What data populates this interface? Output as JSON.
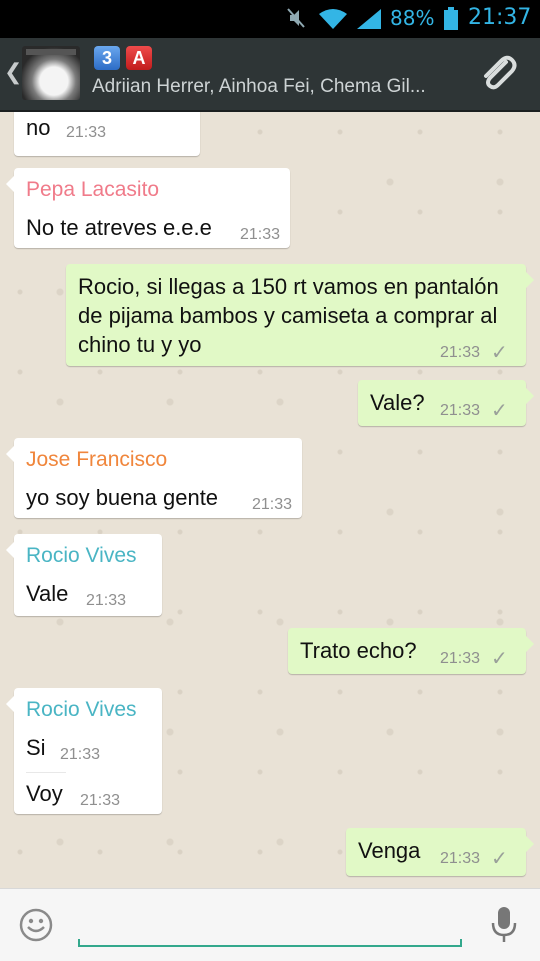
{
  "status_bar": {
    "battery_percent": "88%",
    "time": "21:37",
    "icons": [
      "mute-icon",
      "wifi-icon",
      "signal-icon",
      "battery-icon"
    ]
  },
  "header": {
    "back_glyph": "❮",
    "group_emoji": [
      "3",
      "A"
    ],
    "participants": "Adriian Herrer, Ainhoa Fei, Chema Gil...",
    "icons": [
      "back-icon",
      "group-avatar",
      "attach-icon"
    ]
  },
  "messages": [
    {
      "dir": "in",
      "sender": "",
      "text": "no",
      "time": "21:33"
    },
    {
      "dir": "in",
      "sender": "Pepa Lacasito",
      "sender_color": "#f07b8a",
      "text": "No te atreves e.e.e",
      "time": "21:33"
    },
    {
      "dir": "out",
      "text": "Rocio, si llegas a 150 rt vamos en pantalón de pijama bambos y camiseta a comprar al chino tu y yo",
      "time": "21:33",
      "status": "sent"
    },
    {
      "dir": "out",
      "text": "Vale?",
      "time": "21:33",
      "status": "sent"
    },
    {
      "dir": "in",
      "sender": "Jose Francisco",
      "sender_color": "#f0863c",
      "text": "yo soy buena gente",
      "time": "21:33"
    },
    {
      "dir": "in",
      "sender": "Rocio Vives",
      "sender_color": "#4ab5c4",
      "text": "Vale",
      "time": "21:33"
    },
    {
      "dir": "out",
      "text": "Trato echo?",
      "time": "21:33",
      "status": "sent"
    },
    {
      "dir": "in",
      "sender": "Rocio Vives",
      "sender_color": "#4ab5c4",
      "lines": [
        {
          "text": "Si",
          "time": "21:33"
        },
        {
          "text": "Voy",
          "time": "21:33"
        }
      ]
    },
    {
      "dir": "out",
      "text": "Venga",
      "time": "21:33",
      "status": "sent"
    }
  ],
  "input": {
    "value": "",
    "placeholder": "",
    "icons": [
      "emoji-icon",
      "mic-icon"
    ]
  },
  "colors": {
    "accent": "#33a88c",
    "out_bubble": "#e1f9c6",
    "header": "#2e3536",
    "status_text": "#33b5e5"
  }
}
